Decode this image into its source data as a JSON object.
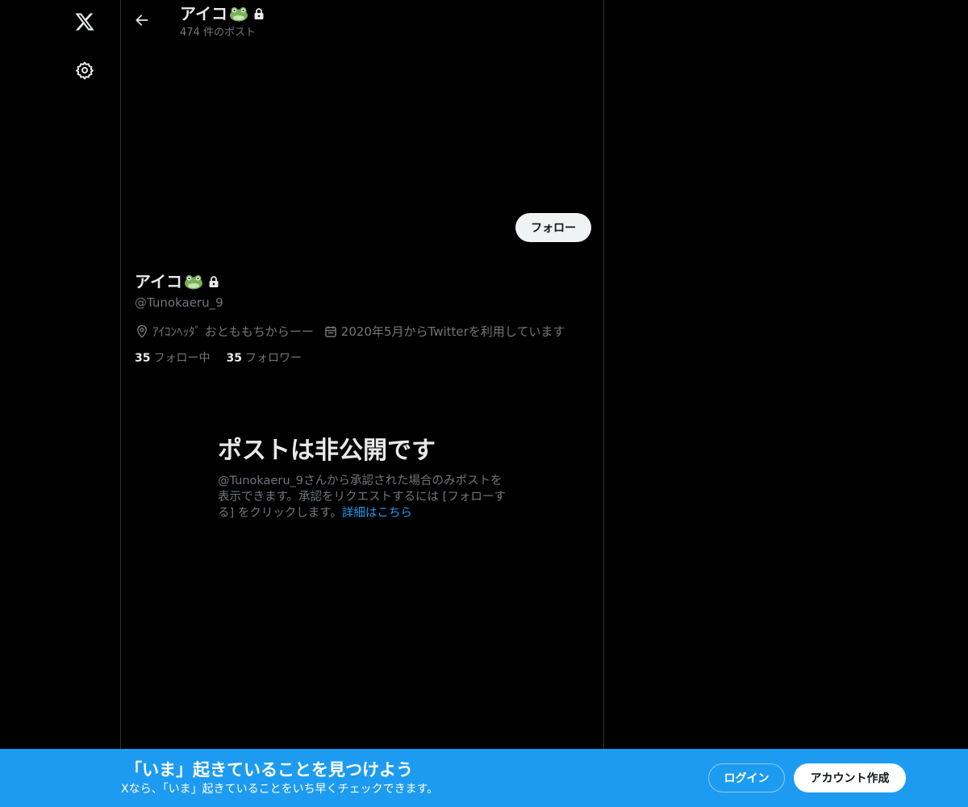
{
  "nav": {
    "logo_icon": "x-logo-icon",
    "settings_icon": "gear-icon"
  },
  "header": {
    "name": "アイコ",
    "post_count": "474 件のポスト"
  },
  "profile": {
    "follow_label": "フォロー",
    "display_name": "アイコ",
    "handle": "@Tunokaeru_9",
    "location": "ｱｲｺﾝﾍｯﾀﾞ おとももちからーー",
    "joined": "2020年5月からTwitterを利用しています",
    "following_count": "35",
    "following_label": "フォロー中",
    "followers_count": "35",
    "followers_label": "フォロワー"
  },
  "private_notice": {
    "title": "ポストは非公開です",
    "description": "@Tunokaeru_9さんから承認された場合のみポストを表示できます。承認をリクエストするには [フォローする] をクリックします。",
    "learn_more": "詳細はこちら"
  },
  "bottom_bar": {
    "title": "「いま」起きていることを見つけよう",
    "subtitle": "Xなら、「いま」起きていることをいち早くチェックできます。",
    "login_label": "ログイン",
    "signup_label": "アカウント作成"
  },
  "colors": {
    "accent": "#1d9bf0",
    "background": "#000000",
    "secondary_text": "#71767b"
  }
}
